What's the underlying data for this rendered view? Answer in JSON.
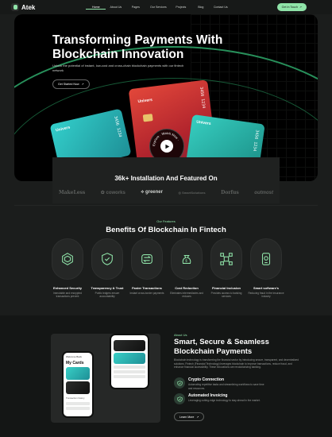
{
  "brand": {
    "name": "Atek"
  },
  "nav": {
    "items": [
      "Home",
      "About Us",
      "Pages",
      "Our Services",
      "Projects",
      "Blog",
      "Contact Us"
    ],
    "cta_label": "Get In Touch"
  },
  "hero": {
    "title": "Transforming Payments With Blockchain Innovation",
    "subtitle": "Unlock the potential of instant, low-cost and cross-chain blockchain payments with our fintech network",
    "button_label": "Get Started Now",
    "card_brand": "Univers",
    "card_number_mid": "3456 1234",
    "card_number_right": "3456 1234",
    "card_number_left": "3456 1234",
    "ring_text": "Explore · Watch Now ·"
  },
  "install": {
    "title": "36k+ Installation And Featured On",
    "logos": [
      "MakeLess",
      "coworks",
      "greener",
      "SmartSolutions",
      "Dorfus",
      "outmost"
    ]
  },
  "features": {
    "tag": "Our Features",
    "title": "Benefits Of Blockchain In Fintech",
    "items": [
      {
        "title": "Enhanced Security",
        "desc": "Immutable and encrypted transactions prevent",
        "icon": "shield-cube-icon"
      },
      {
        "title": "Transparency & Trust",
        "desc": "Public ledgers ensure accountability",
        "icon": "shield-check-icon"
      },
      {
        "title": "Faster Transactions",
        "desc": "Instant cross-border payments",
        "icon": "exchange-arrows-icon"
      },
      {
        "title": "Cost Reduction",
        "desc": "Eliminates intermediaries and reduces",
        "icon": "money-bag-icon"
      },
      {
        "title": "Financial Inclusion",
        "desc": "Provides access to banking services",
        "icon": "network-nodes-icon"
      },
      {
        "title": "Smart software's",
        "desc": "Reducing fraud in the insurance industry",
        "icon": "smartphone-icon"
      }
    ]
  },
  "about": {
    "tag": "About Us",
    "title": "Smart, Secure & Seamless Blockchain Payments",
    "description": "Blockchain technology is transforming the financial sector by introducing secure, transparent, and decentralized solutions. Fintech (Financial Technology) leverages blockchain to improve transactions, reduce fraud, and enhance financial accessibility. These innovations are revolutionizing banking.",
    "items": [
      {
        "title": "Crypto Connection",
        "desc": "Automating repetitive tasks and streamlining workflows to save time and resources."
      },
      {
        "title": "Automated Invoicing",
        "desc": "Leveraging cutting-edge technology to stay ahead in the market."
      }
    ],
    "button_label": "Learn More",
    "phone": {
      "greeting": "Welcome Back",
      "title": "My Cards",
      "history_label": "Transaction history"
    }
  },
  "colors": {
    "accent": "#8fe3a8",
    "background": "#1b1d1c",
    "hero_bg": "#000000",
    "teal_card": "#33cfcb",
    "red_card": "#d9383a"
  }
}
